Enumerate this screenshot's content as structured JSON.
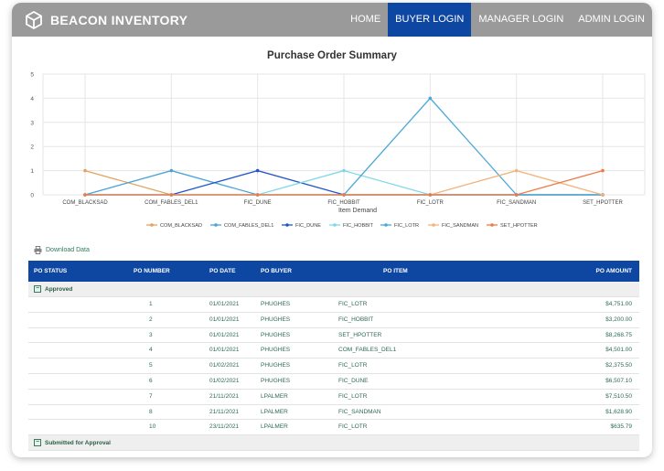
{
  "app": {
    "name": "BEACON INVENTORY"
  },
  "nav": [
    {
      "label": "HOME",
      "active": false
    },
    {
      "label": "BUYER LOGIN",
      "active": true
    },
    {
      "label": "MANAGER LOGIN",
      "active": false
    },
    {
      "label": "ADMIN LOGIN",
      "active": false
    }
  ],
  "chart_data": {
    "type": "line",
    "title": "Purchase Order Summary",
    "xlabel": "Item Demand",
    "ylabel": "",
    "ylim": [
      0,
      5
    ],
    "yticks": [
      "0",
      "1",
      "2",
      "3",
      "4",
      "5"
    ],
    "grid": true,
    "legend_position": "bottom",
    "categories": [
      "COM_BLACKSAD",
      "COM_FABLES_DEL1",
      "FIC_DUNE",
      "FIC_HOBBIT",
      "FIC_LOTR",
      "FIC_SANDMAN",
      "SET_HPOTTER"
    ],
    "series": [
      {
        "name": "COM_BLACKSAD",
        "color": "#e0a45f",
        "values": [
          1,
          0,
          0,
          0,
          0,
          0,
          0
        ]
      },
      {
        "name": "COM_FABLES_DEL1",
        "color": "#4aa3d6",
        "values": [
          0,
          1,
          0,
          0,
          0,
          0,
          0
        ]
      },
      {
        "name": "FIC_DUNE",
        "color": "#2255cc",
        "values": [
          0,
          0,
          1,
          0,
          0,
          0,
          0
        ]
      },
      {
        "name": "FIC_HOBBIT",
        "color": "#7fd8e8",
        "values": [
          0,
          0,
          0,
          1,
          0,
          0,
          0
        ]
      },
      {
        "name": "FIC_LOTR",
        "color": "#49a8d8",
        "values": [
          0,
          0,
          0,
          0,
          4,
          0,
          0
        ]
      },
      {
        "name": "FIC_SANDMAN",
        "color": "#f2b37d",
        "values": [
          0,
          0,
          0,
          0,
          0,
          1,
          0
        ]
      },
      {
        "name": "SET_HPOTTER",
        "color": "#f07a45",
        "values": [
          0,
          0,
          0,
          0,
          0,
          0,
          1
        ]
      }
    ]
  },
  "download": {
    "label": "Download Data"
  },
  "table": {
    "headers": {
      "status": "PO STATUS",
      "number": "PO NUMBER",
      "date": "PO DATE",
      "buyer": "PO BUYER",
      "item": "PO ITEM",
      "amount": "PO AMOUNT"
    },
    "groups": [
      {
        "label": "Approved",
        "rows": [
          {
            "number": "1",
            "date": "01/01/2021",
            "buyer": "PHUGHES",
            "item": "FIC_LOTR",
            "amount": "$4,751.00"
          },
          {
            "number": "2",
            "date": "01/01/2021",
            "buyer": "PHUGHES",
            "item": "FIC_HOBBIT",
            "amount": "$3,200.00"
          },
          {
            "number": "3",
            "date": "01/01/2021",
            "buyer": "PHUGHES",
            "item": "SET_HPOTTER",
            "amount": "$8,268.75"
          },
          {
            "number": "4",
            "date": "01/01/2021",
            "buyer": "PHUGHES",
            "item": "COM_FABLES_DEL1",
            "amount": "$4,501.00"
          },
          {
            "number": "5",
            "date": "01/02/2021",
            "buyer": "PHUGHES",
            "item": "FIC_LOTR",
            "amount": "$2,375.50"
          },
          {
            "number": "6",
            "date": "01/02/2021",
            "buyer": "PHUGHES",
            "item": "FIC_DUNE",
            "amount": "$6,507.10"
          },
          {
            "number": "7",
            "date": "21/11/2021",
            "buyer": "LPALMER",
            "item": "FIC_LOTR",
            "amount": "$7,510.50"
          },
          {
            "number": "8",
            "date": "21/11/2021",
            "buyer": "LPALMER",
            "item": "FIC_SANDMAN",
            "amount": "$1,628.90"
          },
          {
            "number": "10",
            "date": "23/11/2021",
            "buyer": "LPALMER",
            "item": "FIC_LOTR",
            "amount": "$635.79"
          }
        ]
      },
      {
        "label": "Submitted for Approval",
        "rows": []
      }
    ]
  }
}
